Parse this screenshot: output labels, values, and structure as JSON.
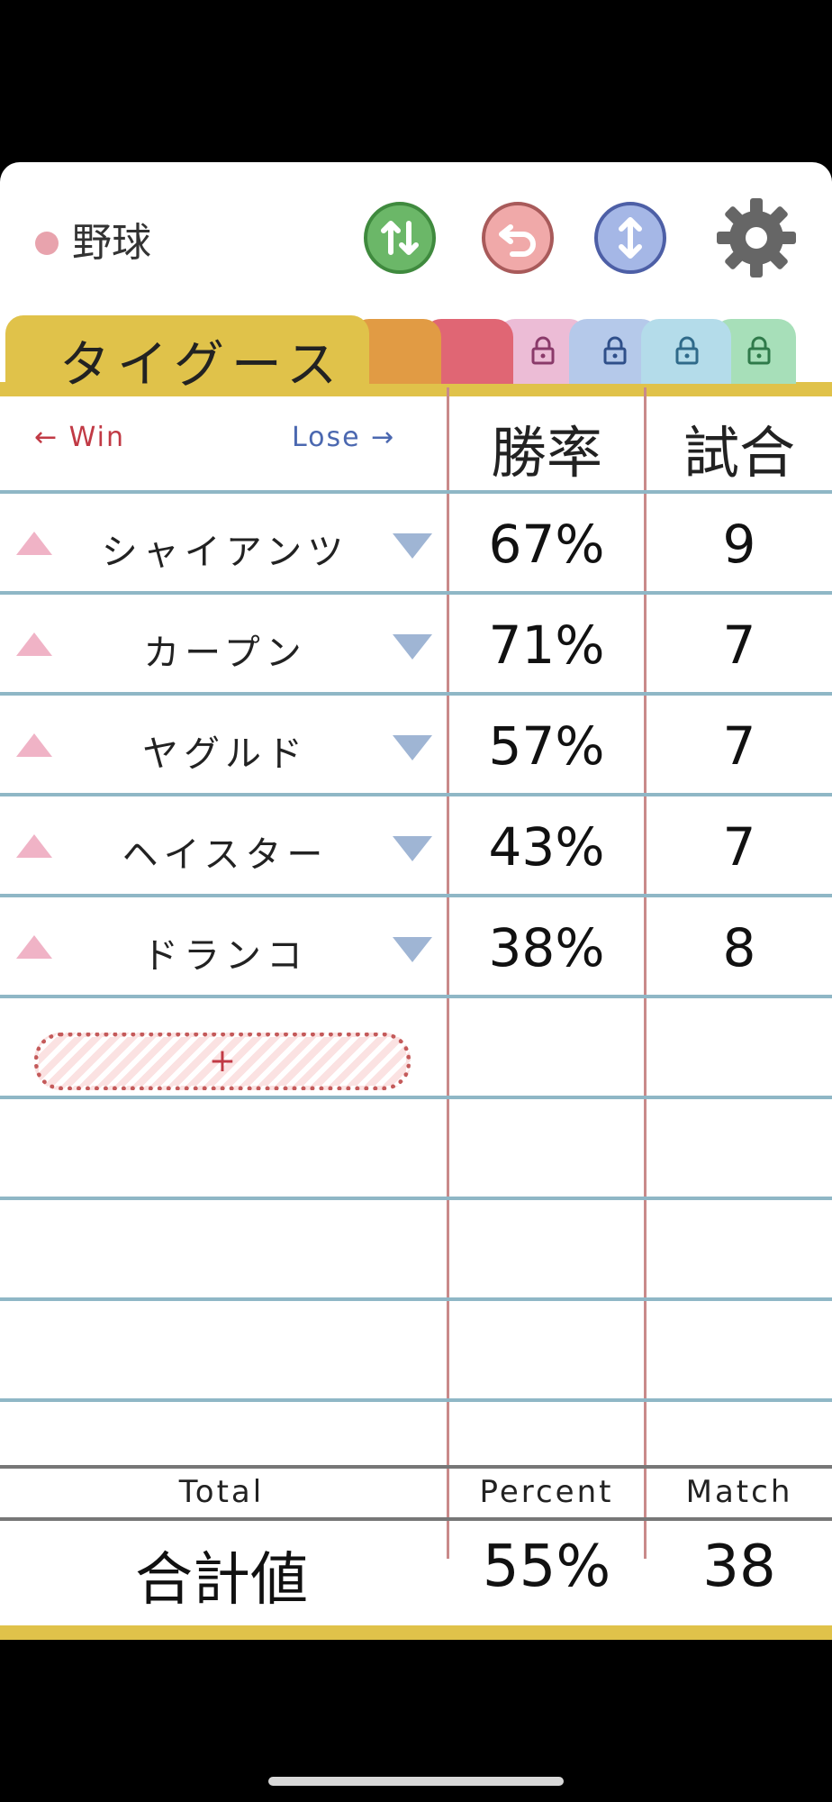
{
  "header": {
    "category_label": "野球",
    "category_dot_color": "#e8a3ad",
    "buttons": [
      "sort-icon",
      "undo-icon",
      "reorder-icon",
      "gear-icon"
    ]
  },
  "tabs": {
    "active_label": "タイグース",
    "colors": [
      "#e0c24a",
      "#e19b44",
      "#e06674",
      "#ecbcd6",
      "#b5c9ea",
      "#b4dcea",
      "#a7dfb9"
    ],
    "locked_icon": "lock-icon"
  },
  "table": {
    "win_label": "← Win",
    "lose_label": "Lose →",
    "col_rate": "勝率",
    "col_games": "試合",
    "rows": [
      {
        "name": "シャイアンツ",
        "rate": "67%",
        "games": "9"
      },
      {
        "name": "カープン",
        "rate": "71%",
        "games": "7"
      },
      {
        "name": "ヤグルド",
        "rate": "57%",
        "games": "7"
      },
      {
        "name": "ヘイスター",
        "rate": "43%",
        "games": "7"
      },
      {
        "name": "ドランコ",
        "rate": "38%",
        "games": "8"
      }
    ],
    "add_label": "+"
  },
  "footer": {
    "total_en": "Total",
    "percent_en": "Percent",
    "match_en": "Match",
    "total_jp": "合計値",
    "percent_value": "55%",
    "match_value": "38"
  }
}
